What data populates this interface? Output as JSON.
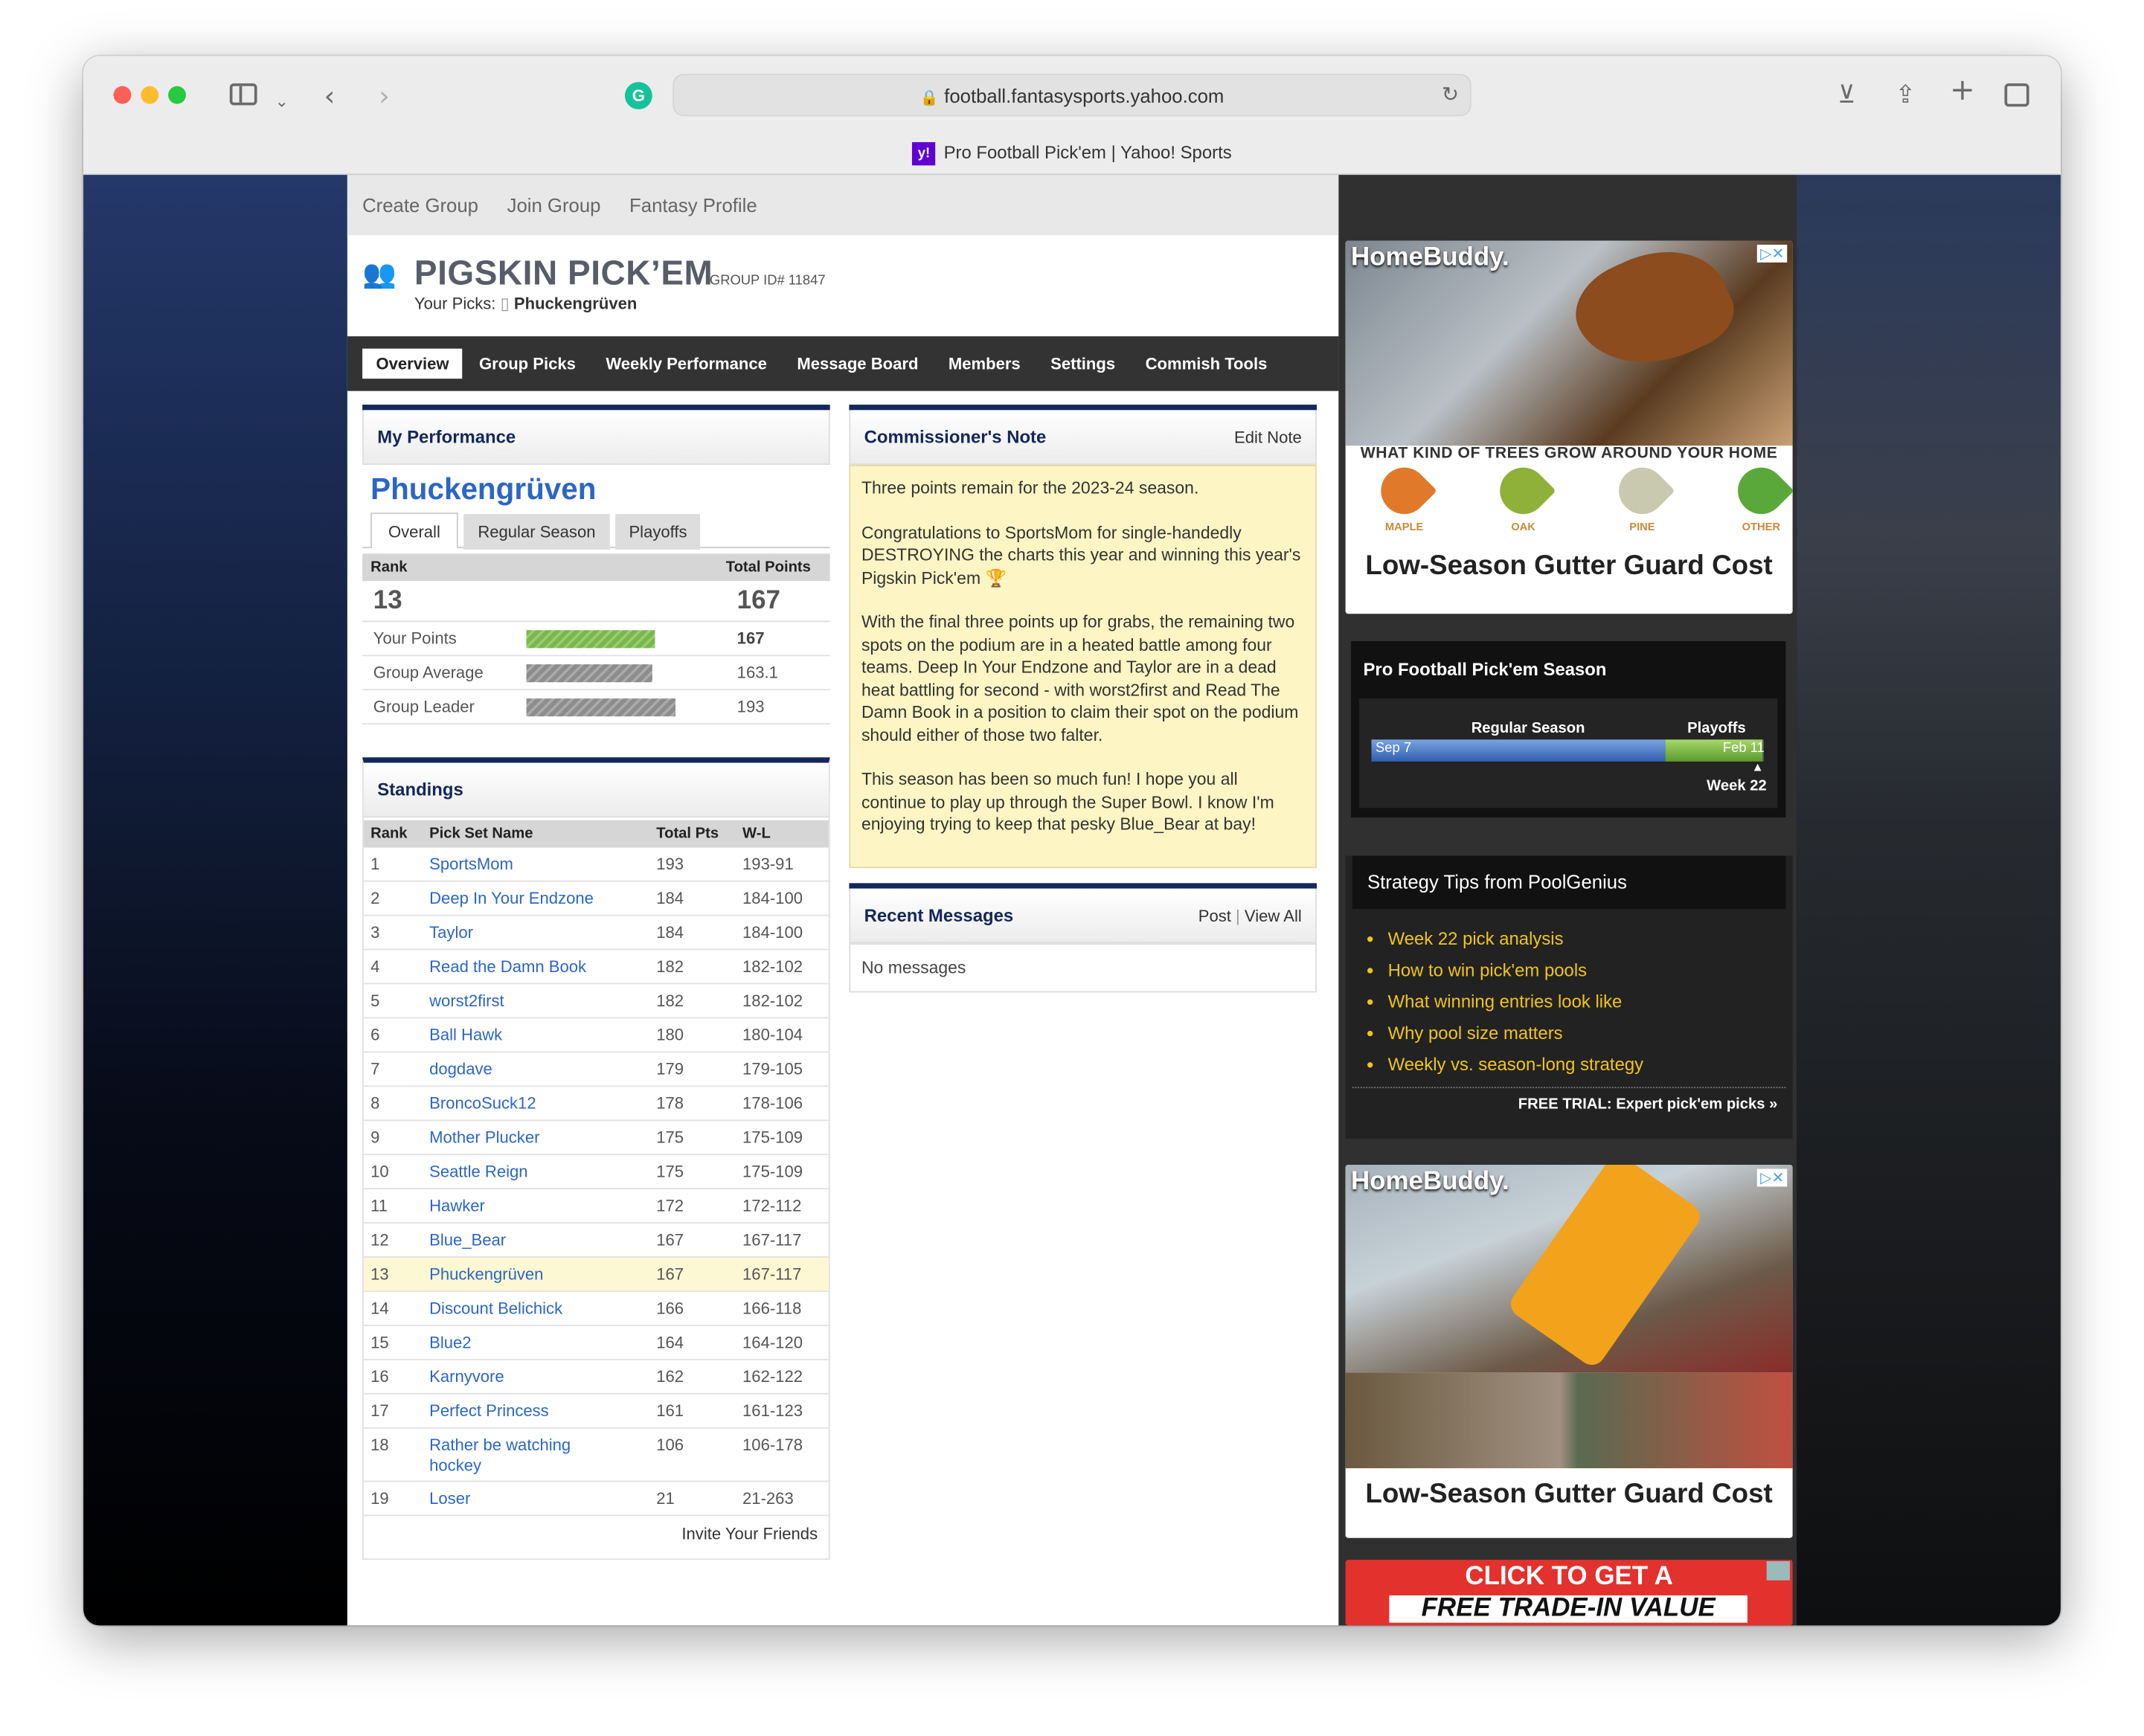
{
  "browser": {
    "url": "football.fantasysports.yahoo.com",
    "tab_title": "Pro Football Pick'em | Yahoo! Sports",
    "tab_favicon": "y!"
  },
  "topnav": [
    "Create Group",
    "Join Group",
    "Fantasy Profile"
  ],
  "group": {
    "name": "PIGSKIN PICK’EM",
    "id_label": "GROUP ID# 11847",
    "your_picks_label": "Your Picks:",
    "your_picks_name": "Phuckengrüven"
  },
  "tabs": [
    "Overview",
    "Group Picks",
    "Weekly Performance",
    "Message Board",
    "Members",
    "Settings",
    "Commish Tools"
  ],
  "performance": {
    "title": "My Performance",
    "name": "Phuckengrüven",
    "subtabs": [
      "Overall",
      "Regular Season",
      "Playoffs"
    ],
    "rank_label": "Rank",
    "points_label": "Total Points",
    "rank": "13",
    "total": "167",
    "bars": [
      {
        "label": "Your Points",
        "value": "167",
        "fraction": 0.865,
        "color": "#79b849"
      },
      {
        "label": "Group Average",
        "value": "163.1",
        "fraction": 0.845,
        "color": "#8d8d8d"
      },
      {
        "label": "Group Leader",
        "value": "193",
        "fraction": 1.0,
        "color": "#8d8d8d"
      }
    ]
  },
  "standings": {
    "title": "Standings",
    "headers": [
      "Rank",
      "Pick Set Name",
      "Total Pts",
      "W-L"
    ],
    "rows": [
      [
        "1",
        "SportsMom",
        "193",
        "193-91"
      ],
      [
        "2",
        "Deep In Your Endzone",
        "184",
        "184-100"
      ],
      [
        "3",
        "Taylor",
        "184",
        "184-100"
      ],
      [
        "4",
        "Read the Damn Book",
        "182",
        "182-102"
      ],
      [
        "5",
        "worst2first",
        "182",
        "182-102"
      ],
      [
        "6",
        "Ball Hawk",
        "180",
        "180-104"
      ],
      [
        "7",
        "dogdave",
        "179",
        "179-105"
      ],
      [
        "8",
        "BroncoSuck12",
        "178",
        "178-106"
      ],
      [
        "9",
        "Mother Plucker",
        "175",
        "175-109"
      ],
      [
        "10",
        "Seattle Reign",
        "175",
        "175-109"
      ],
      [
        "11",
        "Hawker",
        "172",
        "172-112"
      ],
      [
        "12",
        "Blue_Bear",
        "167",
        "167-117"
      ],
      [
        "13",
        "Phuckengrüven",
        "167",
        "167-117"
      ],
      [
        "14",
        "Discount Belichick",
        "166",
        "166-118"
      ],
      [
        "15",
        "Blue2",
        "164",
        "164-120"
      ],
      [
        "16",
        "Karnyvore",
        "162",
        "162-122"
      ],
      [
        "17",
        "Perfect Princess",
        "161",
        "161-123"
      ],
      [
        "18",
        "Rather be watching hockey",
        "106",
        "106-178"
      ],
      [
        "19",
        "Loser",
        "21",
        "21-263"
      ]
    ],
    "highlight_rank": "13",
    "invite": "Invite Your Friends"
  },
  "note": {
    "title": "Commissioner's Note",
    "edit": "Edit Note",
    "paragraphs": [
      "Three points remain for the 2023-24 season.",
      "Congratulations to SportsMom for single-handedly DESTROYING the charts this year and winning this year's Pigskin Pick'em 🏆",
      "With the final three points up for grabs, the remaining two spots on the podium are in a heated battle among four teams. Deep In Your Endzone and Taylor are in a dead heat battling for second - with worst2first and Read The Damn Book in a position to claim their spot on the podium should either of those two falter.",
      "This season has been so much fun! I hope you all continue to play up through the Super Bowl. I know I'm enjoying trying to keep that pesky Blue_Bear at bay!"
    ]
  },
  "messages": {
    "title": "Recent Messages",
    "post": "Post",
    "view_all": "View All",
    "empty": "No messages"
  },
  "ad1": {
    "brand": "HomeBuddy.",
    "question": "WHAT KIND OF TREES GROW AROUND YOUR HOME",
    "trees": [
      "MAPLE",
      "OAK",
      "PINE",
      "OTHER"
    ],
    "headline": "Low-Season Gutter Guard Cost"
  },
  "season": {
    "title": "Pro Football Pick'em Season",
    "regular": "Regular Season",
    "playoffs": "Playoffs",
    "start": "Sep 7",
    "end": "Feb 11",
    "week": "Week 22",
    "progress": 0.985
  },
  "tips": {
    "title": "Strategy Tips from PoolGenius",
    "items": [
      "Week 22 pick analysis",
      "How to win pick'em pools",
      "What winning entries look like",
      "Why pool size matters",
      "Weekly vs. season-long strategy"
    ],
    "cta": "FREE TRIAL: Expert pick'em picks »"
  },
  "ad2": {
    "brand": "HomeBuddy.",
    "headline": "Low-Season Gutter Guard Cost"
  },
  "ad3": {
    "line1": "CLICK TO GET A",
    "line2": "FREE TRADE-IN VALUE"
  },
  "colors": {
    "navy": "#13275a",
    "link": "#2c66c4",
    "tips_link": "#f0c419",
    "highlight": "#fdf8d4"
  }
}
